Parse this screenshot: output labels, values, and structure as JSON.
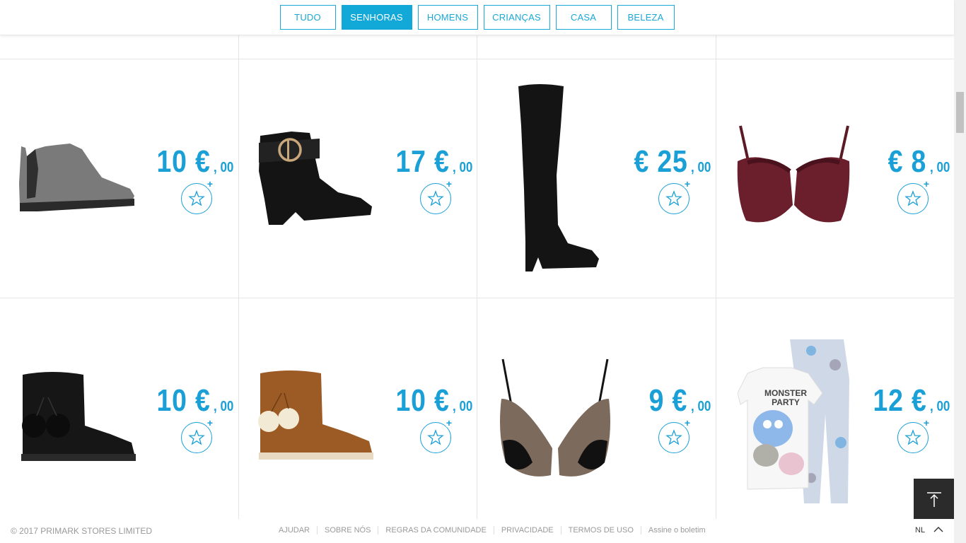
{
  "nav": {
    "tabs": [
      {
        "label": "TUDO",
        "active": false
      },
      {
        "label": "SENHORAS",
        "active": true
      },
      {
        "label": "HOMENS",
        "active": false
      },
      {
        "label": "CRIANÇAS",
        "active": false
      },
      {
        "label": "CASA",
        "active": false
      },
      {
        "label": "BELEZA",
        "active": false
      }
    ]
  },
  "products": [
    {
      "type": "ankle-boot-grey",
      "price_main": "10 €",
      "price_cents": ", 00"
    },
    {
      "type": "ankle-boot-buckle-black",
      "price_main": "17 €",
      "price_cents": ", 00"
    },
    {
      "type": "over-knee-boot-black",
      "price_main": "€ 25",
      "price_cents": ", 00"
    },
    {
      "type": "bra-burgundy",
      "price_main": "€ 8",
      "price_cents": ", 00"
    },
    {
      "type": "pompom-boot-black",
      "price_main": "10 €",
      "price_cents": ", 00"
    },
    {
      "type": "pompom-boot-tan",
      "price_main": "10 €",
      "price_cents": ", 00"
    },
    {
      "type": "bra-black-lace",
      "price_main": "9 €",
      "price_cents": ", 00"
    },
    {
      "type": "pyjama-monster-party",
      "price_main": "12 €",
      "price_cents": ", 00",
      "print_text": "MONSTER PARTY"
    }
  ],
  "footer": {
    "copyright": "© 2017 PRIMARK STORES LIMITED",
    "links": [
      "AJUDAR",
      "SOBRE NÓS",
      "REGRAS DA COMUNIDADE",
      "PRIVACIDADE",
      "TERMOS DE USO",
      "Assine o boletim"
    ],
    "language": "NL"
  },
  "colors": {
    "accent": "#12a9d9",
    "price": "#1aa0d6",
    "back_to_top": "#2b2b2b"
  }
}
